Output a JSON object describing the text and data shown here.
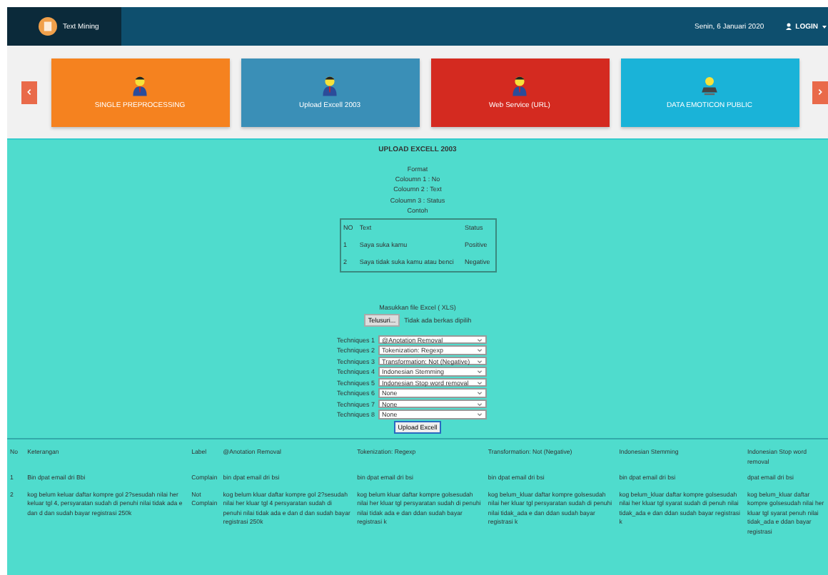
{
  "navbar": {
    "brand": "Text Mining",
    "date": "Senin, 6 Januari 2020",
    "login": "LOGIN"
  },
  "cards": [
    {
      "label": "SINGLE PREPROCESSING",
      "color": "#f5821f",
      "kind": "person"
    },
    {
      "label": "Upload Excell 2003",
      "color": "#3a8fb7",
      "kind": "person"
    },
    {
      "label": "Web Service (URL)",
      "color": "#d42a20",
      "kind": "person"
    },
    {
      "label": "DATA EMOTICON PUBLIC",
      "color": "#1ab3d8",
      "kind": "monitor"
    }
  ],
  "upload": {
    "title": "UPLOAD EXCELL 2003",
    "format_lines": [
      "Format",
      "Coloumn 1 : No",
      "Coloumn 2 : Text",
      "Coloumn 3 : Status",
      "Contoh"
    ],
    "example": {
      "columns": [
        "NO",
        "Text",
        "Status"
      ],
      "rows": [
        [
          "1",
          "Saya suka kamu",
          "Positive"
        ],
        [
          "2",
          "Saya tidak suka kamu atau benci",
          "Negative"
        ]
      ]
    },
    "file_label": "Masukkan file Excel ( XLS)",
    "browse_button": "Telusuri...",
    "no_file": "Tidak ada berkas dipilih",
    "techniques": [
      {
        "label": "Techniques 1",
        "value": "@Anotation Removal"
      },
      {
        "label": "Techniques 2",
        "value": "Tokenization: Regexp"
      },
      {
        "label": "Techniques 3",
        "value": "Transformation: Not (Negative)"
      },
      {
        "label": "Techniques 4",
        "value": "Indonesian Stemming"
      },
      {
        "label": "Techniques 5",
        "value": "Indonesian Stop word removal"
      },
      {
        "label": "Techniques 6",
        "value": "None"
      },
      {
        "label": "Techniques 7",
        "value": "None"
      },
      {
        "label": "Techniques 8",
        "value": "None"
      }
    ],
    "submit": "Upload Excell"
  },
  "results": {
    "columns": [
      "No",
      "Keterangan",
      "Label",
      "@Anotation Removal",
      "Tokenization: Regexp",
      "Transformation: Not (Negative)",
      "Indonesian Stemming",
      "Indonesian Stop word removal"
    ],
    "rows": [
      [
        "1",
        "Bin dpat email dri Bbi",
        "Complain",
        "bin dpat email dri bsi",
        "bin dpat email dri bsi",
        "bin dpat email dri bsi",
        "bin dpat email dri bsi",
        "dpat email dri bsi"
      ],
      [
        "2",
        "kog belum keluar daftar kompre gol 2?sesudah nilai her keluar tgl 4, persyaratan sudah di penuhi nilai tidak ada e dan d dan sudah bayar registrasi 250k",
        "Not Complain",
        "kog belum kluar daftar kompre gol 2?sesudah nilai her kluar tgl 4 persyaratan sudah di penuhi nilai tidak ada e dan d dan sudah bayar registrasi 250k",
        "kog belum kluar daftar kompre golsesudah nilai her kluar tgl persyaratan sudah di penuhi nilai tidak ada e dan ddan sudah bayar registrasi k",
        "kog belum_kluar daftar kompre golsesudah nilai her kluar tgl persyaratan sudah di penuhi nilai tidak_ada e dan ddan sudah bayar registrasi k",
        "kog belum_kluar daftar kompre golsesudah nilai her kluar tgl syarat sudah di penuh nilai tidak_ada e dan ddan sudah bayar registrasi k",
        "kog belum_kluar daftar kompre golsesudah nilai her kluar tgl syarat penuh nilai tidak_ada e ddan bayar registrasi"
      ]
    ]
  }
}
